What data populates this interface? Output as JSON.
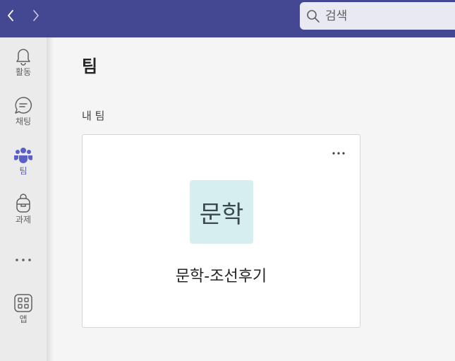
{
  "search": {
    "placeholder": "검색",
    "icon": "search-icon"
  },
  "rail": {
    "items": [
      {
        "label": "활동",
        "icon": "bell-icon"
      },
      {
        "label": "채팅",
        "icon": "chat-icon"
      },
      {
        "label": "팀",
        "icon": "teams-icon",
        "active": true
      },
      {
        "label": "과제",
        "icon": "backpack-icon"
      },
      {
        "label": "",
        "icon": "more-icon"
      },
      {
        "label": "앱",
        "icon": "apps-icon"
      }
    ]
  },
  "main": {
    "title": "팀",
    "section_label": "내 팀",
    "teams": [
      {
        "avatar_text": "문학",
        "name": "문학-조선후기",
        "avatar_color": "#d6eef0"
      }
    ]
  },
  "colors": {
    "topbar": "#444791",
    "accent": "#5b5fc7",
    "rail_bg": "#ebebeb"
  }
}
